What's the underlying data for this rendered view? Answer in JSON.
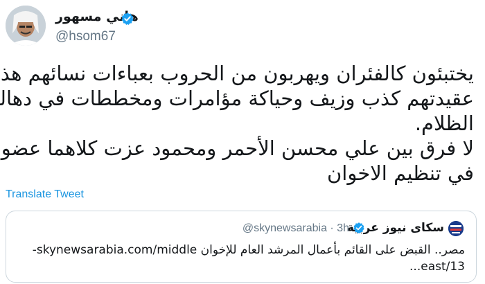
{
  "author": {
    "display_name": "هاني مسهور",
    "handle": "@hsom67"
  },
  "tweet": {
    "lines": [
      "يختبئون كالفئران ويهربون من الحروب بعباءات نسائهم هذه",
      "عقيدتهم كذب وزيف وحياكة مؤامرات ومخططات في دهاليز",
      "الظلام.",
      "لا فرق بين علي محسن الأحمر ومحمود عزت كلاهما عضوان",
      "في تنظيم الاخوان"
    ]
  },
  "translate_label": "Translate Tweet",
  "quoted": {
    "display_name": "سكاى نيوز عربية",
    "handle": "@skynewsarabia",
    "separator": "·",
    "time": "3h",
    "text_line1": "مصر.. القبض على القائم بأعمال المرشد العام للإخوان skynewsarabia.com/middle-",
    "text_line2": "east/13..."
  },
  "colors": {
    "link": "#1b95e0",
    "verified": "#1da1f2",
    "muted": "#657786",
    "border": "#ccd6dd"
  }
}
